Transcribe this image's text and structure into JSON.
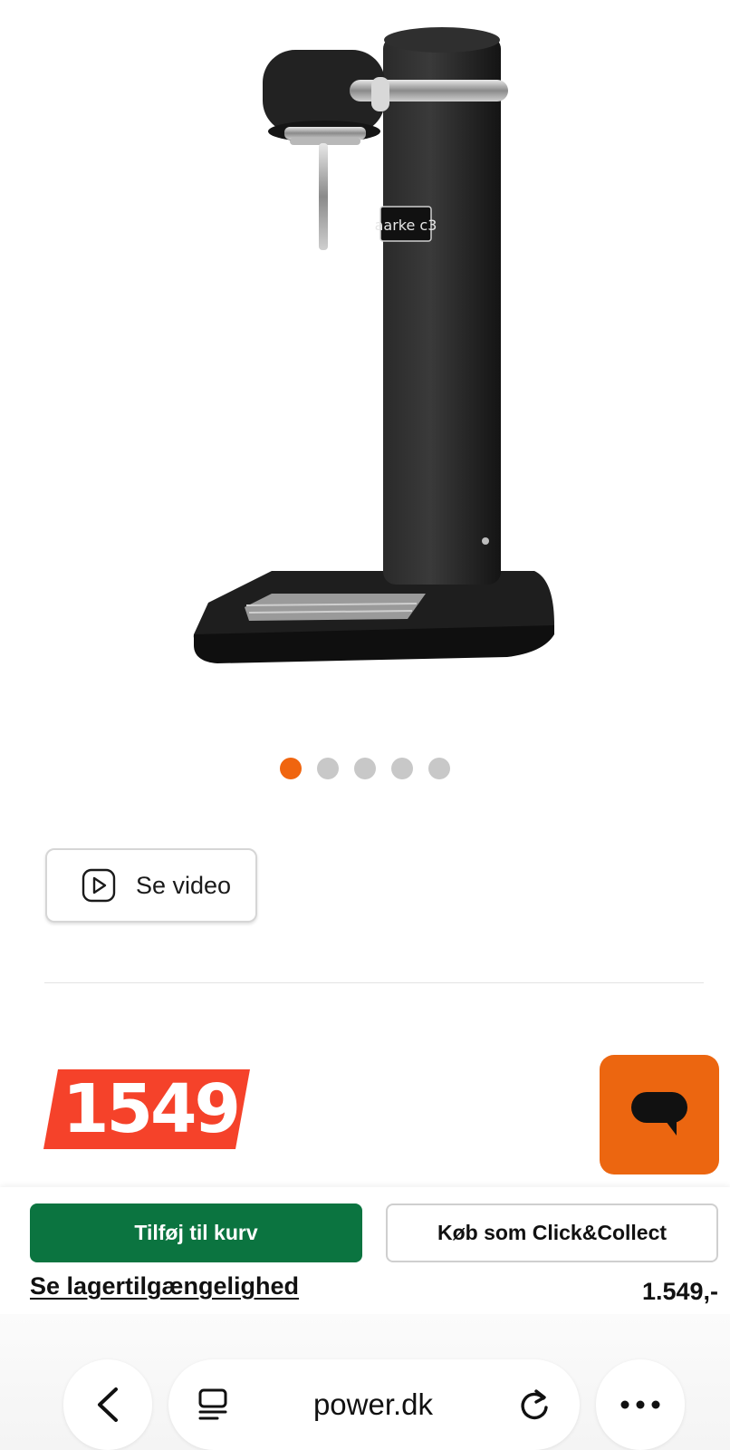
{
  "product": {
    "image_alt": "Aarke Carbonator 3 sodavandsmaskine, sort",
    "brand_mark": "aarke c3"
  },
  "carousel": {
    "total": 5,
    "active_index": 1
  },
  "video_button": {
    "label": "Se video",
    "icon": "play-icon"
  },
  "price": {
    "badge": "1549",
    "badge_color": "#f5422a",
    "formatted": "1.549,-"
  },
  "chat": {
    "icon": "chat-bubble-icon",
    "color": "#ec6610"
  },
  "actions": {
    "add_to_cart": "Tilføj til kurv",
    "click_collect": "Køb som Click&Collect",
    "stock_link": "Se lagertilgængelighed",
    "cart_color": "#0b7440"
  },
  "browser": {
    "url": "power.dk",
    "icons": [
      "back-icon",
      "tabs-icon",
      "reload-icon",
      "more-icon"
    ]
  }
}
